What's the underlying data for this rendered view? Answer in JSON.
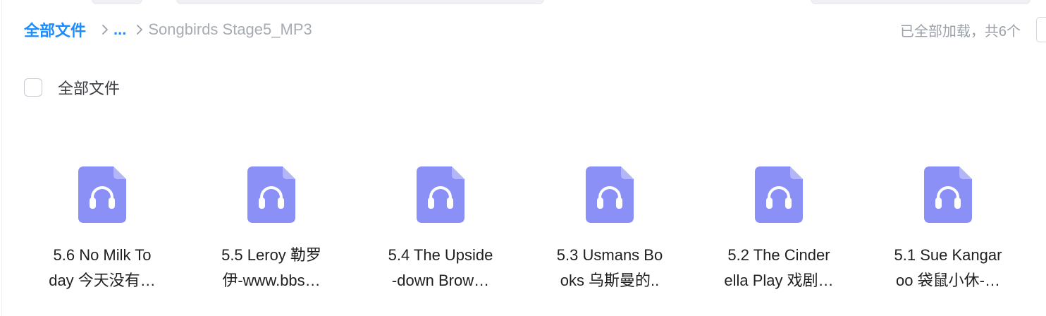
{
  "breadcrumb": {
    "root": "全部文件",
    "more": "...",
    "current": "Songbirds Stage5_MP3"
  },
  "status": {
    "load_text": "已全部加载，共6个"
  },
  "select_all": {
    "label": "全部文件",
    "checked": false
  },
  "files": [
    {
      "line1": "5.6 No Milk To",
      "line2": "day 今天没有…",
      "icon": "audio-file-icon"
    },
    {
      "line1": "5.5 Leroy 勒罗",
      "line2": "伊-www.bbs…",
      "icon": "audio-file-icon"
    },
    {
      "line1": "5.4 The Upside",
      "line2": "-down Brow…",
      "icon": "audio-file-icon"
    },
    {
      "line1": "5.3 Usmans Bo",
      "line2": "oks 乌斯曼的..",
      "icon": "audio-file-icon"
    },
    {
      "line1": "5.2 The Cinder",
      "line2": "ella Play 戏剧…",
      "icon": "audio-file-icon"
    },
    {
      "line1": "5.1 Sue Kangar",
      "line2": "oo 袋鼠小休-…",
      "icon": "audio-file-icon"
    }
  ],
  "colors": {
    "accent": "#1a8cff",
    "icon_fill": "#8a90f5",
    "muted_text": "#9aa0a8"
  }
}
